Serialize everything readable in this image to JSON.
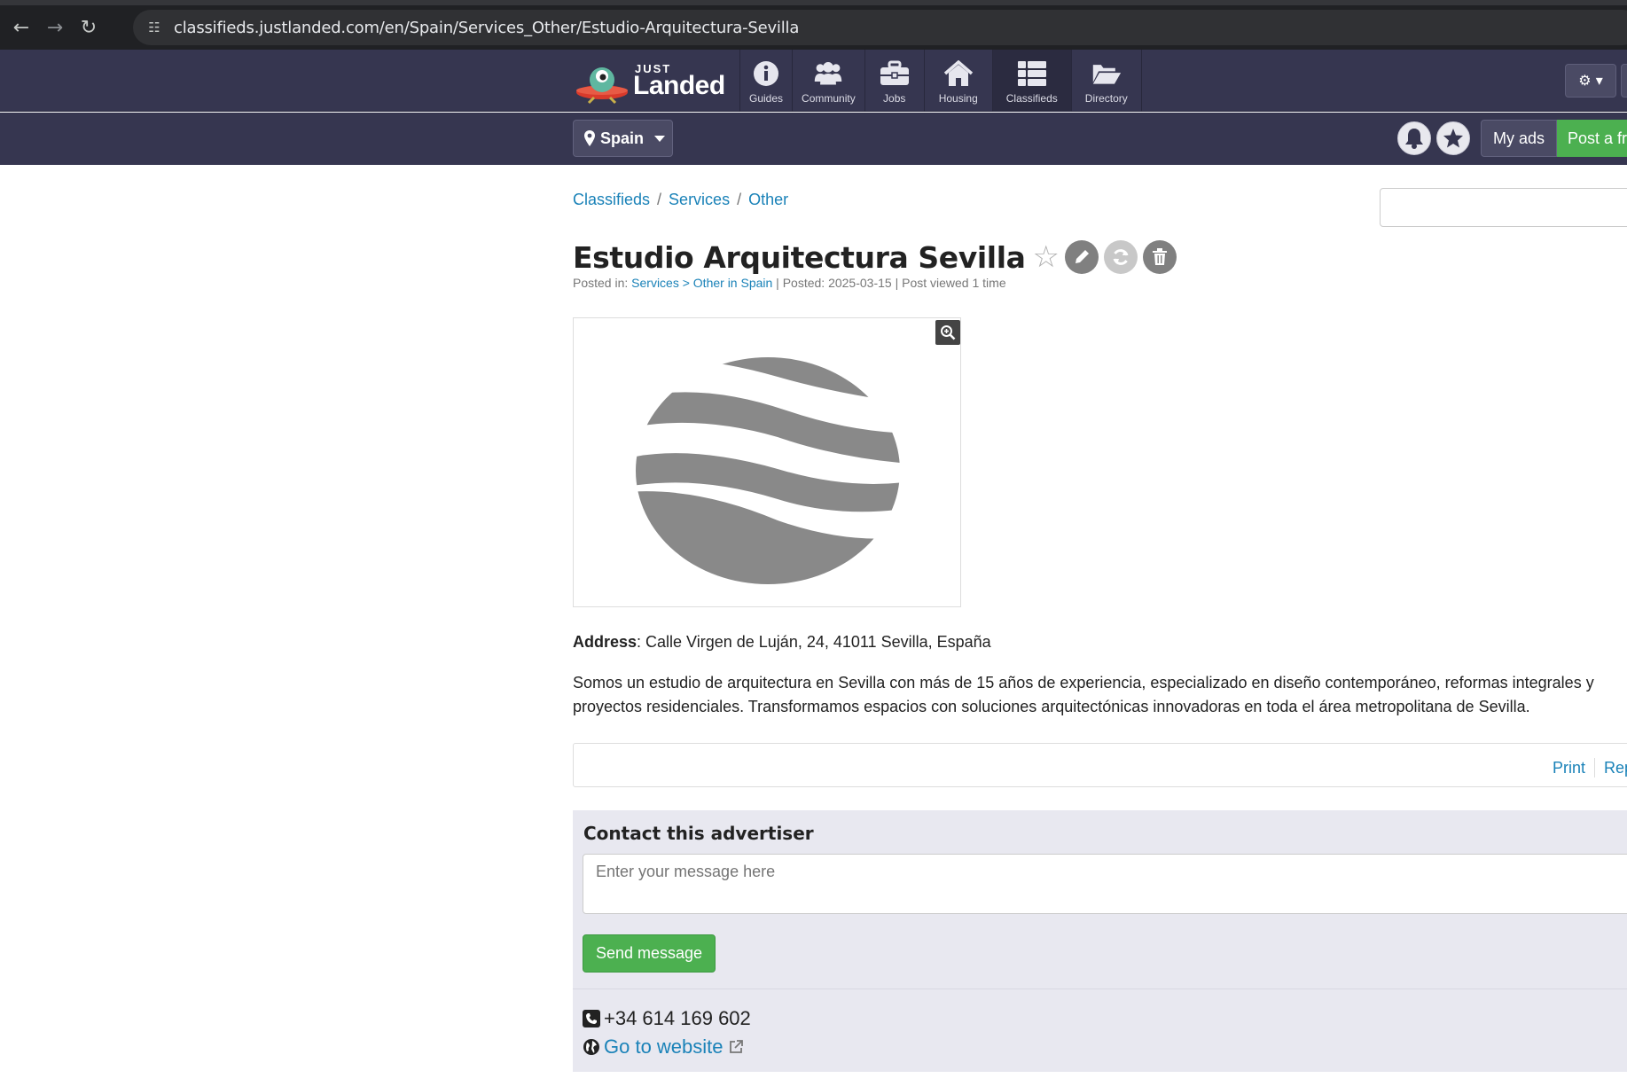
{
  "browser": {
    "url": "classifieds.justlanded.com/en/Spain/Services_Other/Estudio-Arquitectura-Sevilla"
  },
  "header": {
    "logo_top": "JUST",
    "logo_main": "Landed",
    "nav": [
      {
        "label": "Guides",
        "icon": "info-icon"
      },
      {
        "label": "Community",
        "icon": "users-icon"
      },
      {
        "label": "Jobs",
        "icon": "briefcase-icon"
      },
      {
        "label": "Housing",
        "icon": "home-icon"
      },
      {
        "label": "Classifieds",
        "icon": "list-icon"
      },
      {
        "label": "Directory",
        "icon": "folder-open-icon"
      }
    ],
    "active_nav": "Classifieds"
  },
  "subheader": {
    "country": "Spain",
    "my_ads": "My ads",
    "post": "Post a fr"
  },
  "breadcrumb": [
    "Classifieds",
    "Services",
    "Other"
  ],
  "listing": {
    "title": "Estudio Arquitectura Sevilla",
    "meta_prefix": "Posted in: ",
    "meta_category": "Services > Other in Spain",
    "meta_suffix": " | Posted: 2025-03-15 | Post viewed 1 time",
    "address_label": "Address",
    "address_value": ": Calle Virgen de Luján, 24, 41011 Sevilla, España",
    "description": "Somos un estudio de arquitectura en Sevilla con más de 15 años de experiencia, especializado en diseño contemporáneo, reformas integrales y proyectos residenciales. Transformamos espacios con soluciones arquitectónicas innovadoras en toda el área metropolitana de Sevilla."
  },
  "tools": {
    "print": "Print",
    "report": "Rep"
  },
  "contact": {
    "title": "Contact this advertiser",
    "placeholder": "Enter your message here",
    "send": "Send message",
    "phone": "+34 614 169 602",
    "website": "Go to website"
  },
  "colors": {
    "header_bg": "#363650",
    "link": "#1a82b8",
    "green": "#4cb050",
    "contact_bg": "#e8e8f0"
  }
}
